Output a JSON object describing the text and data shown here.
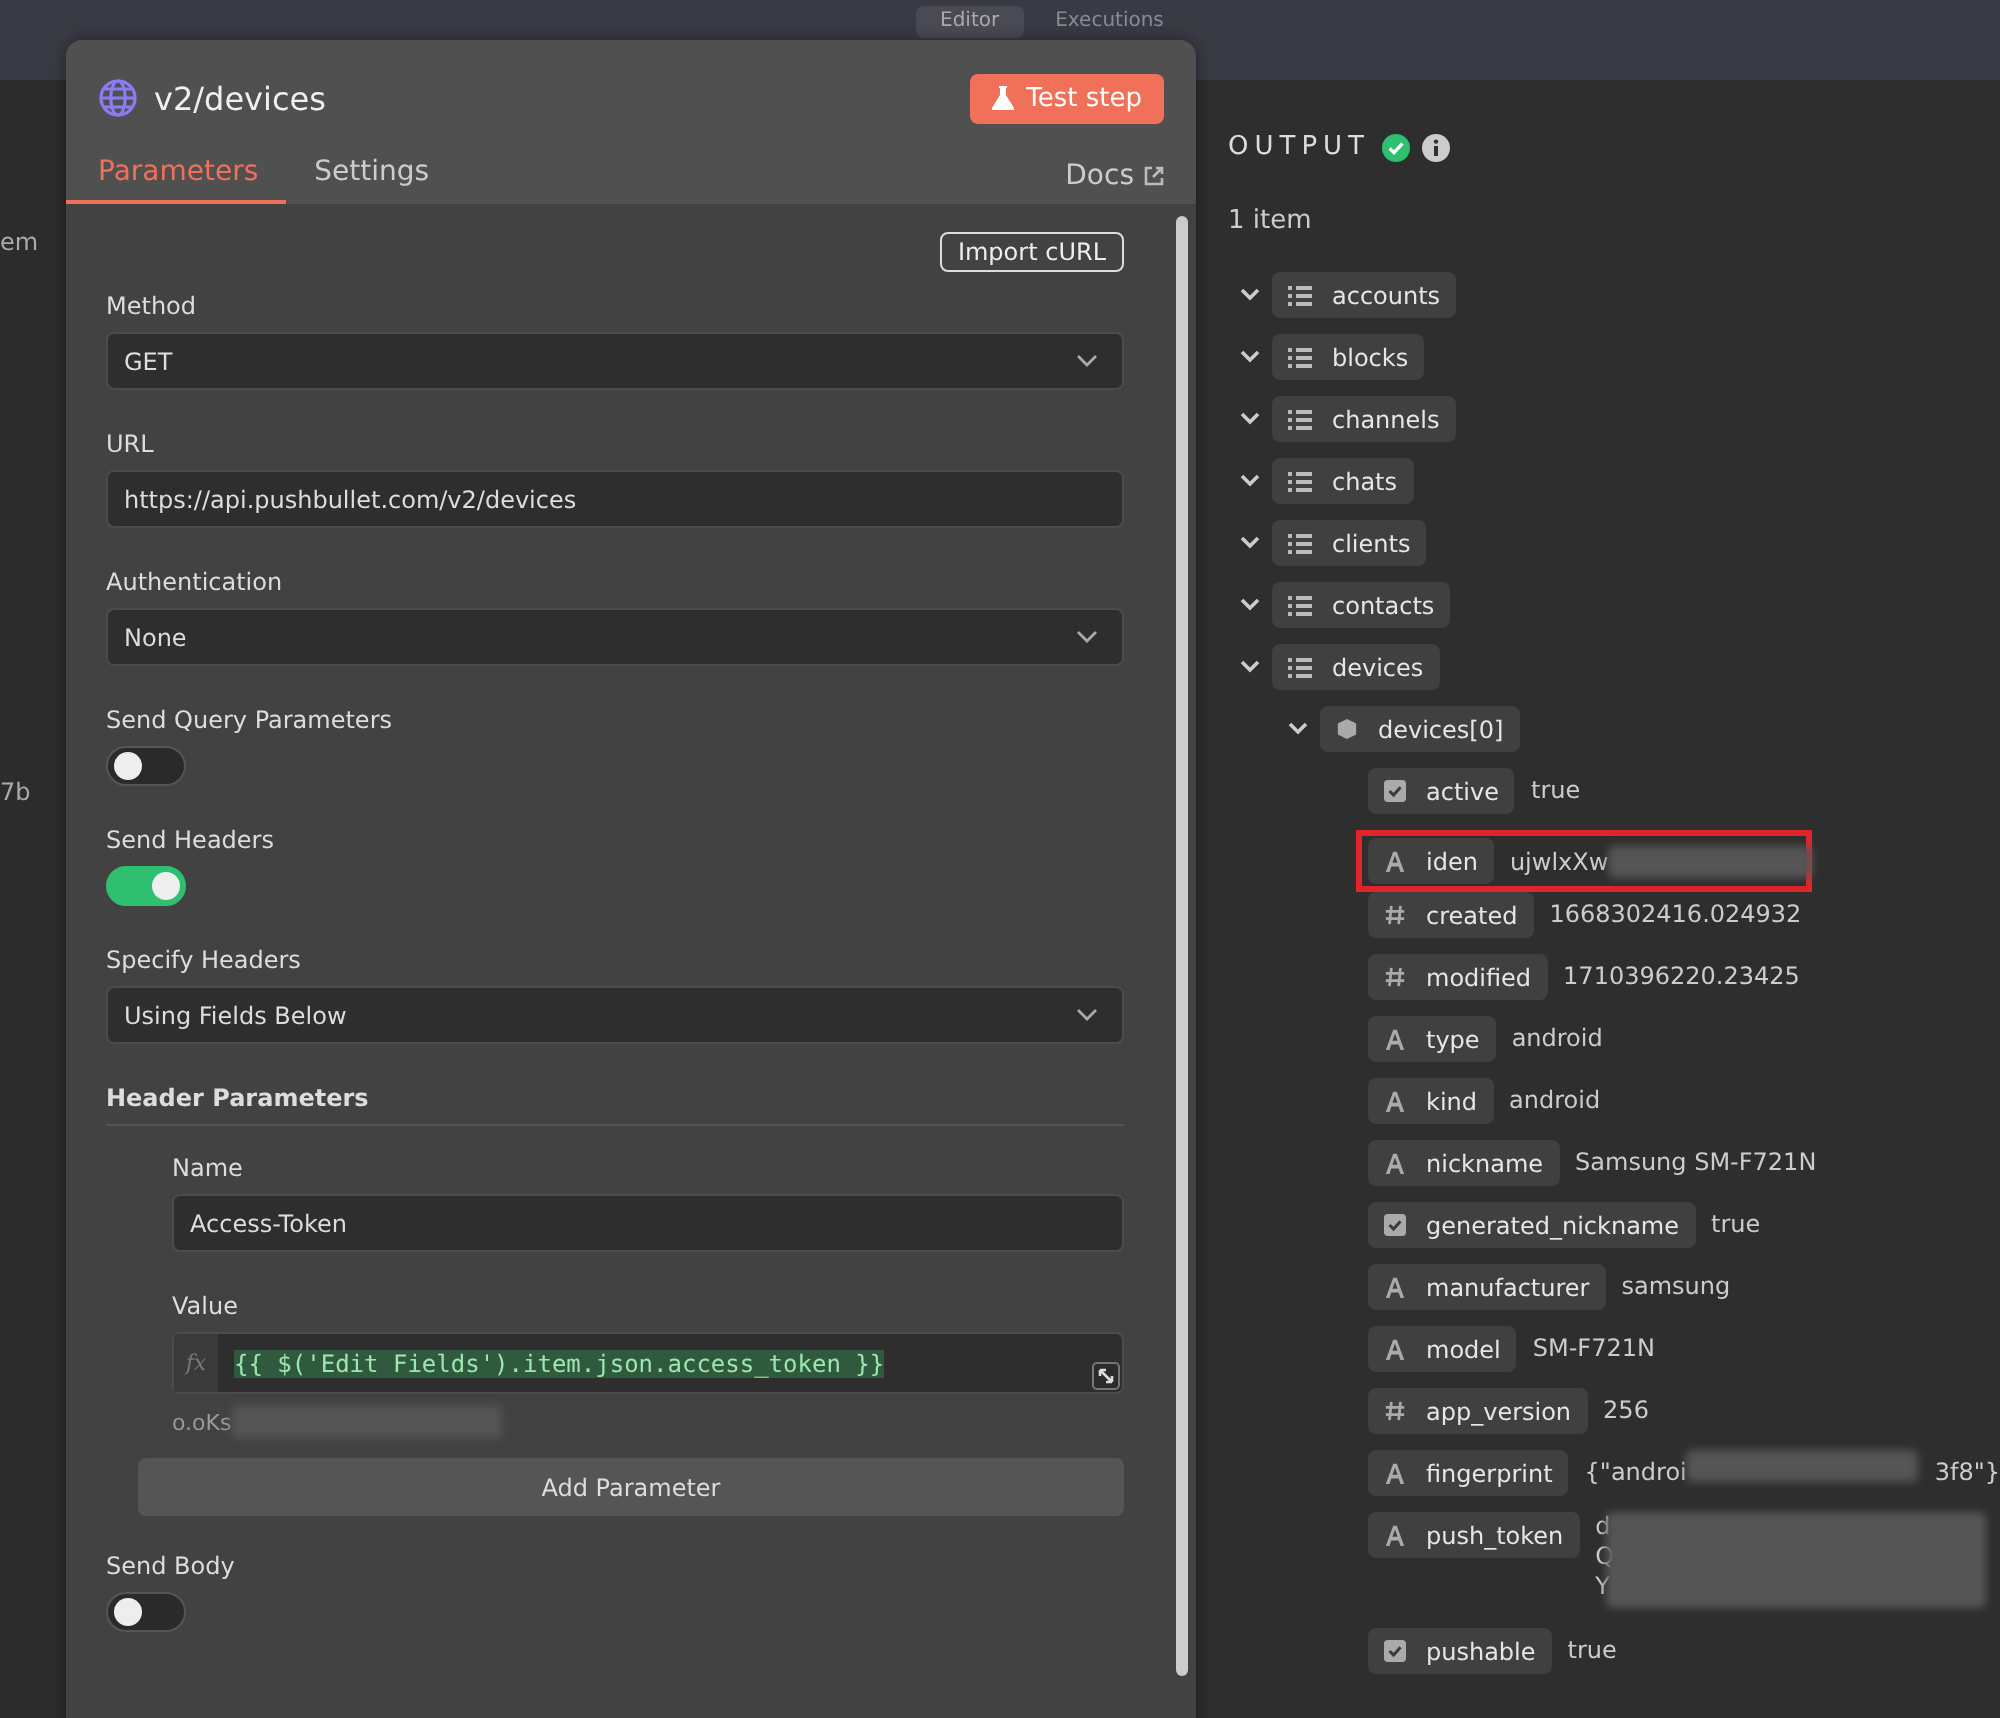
{
  "top_tabs": [
    {
      "label": "Editor",
      "selected": true
    },
    {
      "label": "Executions",
      "selected": false
    }
  ],
  "background_fragments": [
    "em",
    "7b"
  ],
  "node_panel": {
    "title": "v2/devices",
    "test_button": "Test step",
    "tabs": [
      {
        "label": "Parameters",
        "selected": true
      },
      {
        "label": "Settings",
        "selected": false
      }
    ],
    "docs_link": "Docs",
    "import_button": "Import cURL",
    "fields": [
      {
        "kind": "select",
        "label": "Method",
        "value": "GET"
      },
      {
        "kind": "input",
        "label": "URL",
        "value": "https://api.pushbullet.com/v2/devices"
      },
      {
        "kind": "select",
        "label": "Authentication",
        "value": "None"
      },
      {
        "kind": "toggle",
        "label": "Send Query Parameters",
        "on": false
      },
      {
        "kind": "toggle",
        "label": "Send Headers",
        "on": true
      },
      {
        "kind": "select",
        "label": "Specify Headers",
        "value": "Using Fields Below"
      },
      {
        "kind": "section",
        "label": "Header Parameters",
        "name_label": "Name",
        "name_value": "Access-Token",
        "value_label": "Value",
        "expression": "{{ $('Edit Fields').item.json.access_token }}",
        "expression_prefix": "fx",
        "resolved_hint": "o.oKs",
        "add_button": "Add Parameter"
      },
      {
        "kind": "toggle",
        "label": "Send Body",
        "on": false
      }
    ]
  },
  "output": {
    "title": "OUTPUT",
    "count": "1 item",
    "tree": [
      {
        "key": "accounts",
        "kind": "array"
      },
      {
        "key": "blocks",
        "kind": "array"
      },
      {
        "key": "channels",
        "kind": "array"
      },
      {
        "key": "chats",
        "kind": "array"
      },
      {
        "key": "clients",
        "kind": "array"
      },
      {
        "key": "contacts",
        "kind": "array"
      },
      {
        "key": "devices",
        "kind": "array",
        "children": [
          {
            "key": "devices[0]",
            "kind": "object",
            "children": [
              {
                "key": "active",
                "kind": "boolean",
                "value": "true"
              },
              {
                "key": "iden",
                "kind": "string",
                "value": "ujwlxXw",
                "redacted": true,
                "highlighted": true
              },
              {
                "key": "created",
                "kind": "number",
                "value": "1668302416.024932"
              },
              {
                "key": "modified",
                "kind": "number",
                "value": "1710396220.23425"
              },
              {
                "key": "type",
                "kind": "string",
                "value": "android"
              },
              {
                "key": "kind",
                "kind": "string",
                "value": "android"
              },
              {
                "key": "nickname",
                "kind": "string",
                "value": "Samsung SM-F721N"
              },
              {
                "key": "generated_nickname",
                "kind": "boolean",
                "value": "true"
              },
              {
                "key": "manufacturer",
                "kind": "string",
                "value": "samsung"
              },
              {
                "key": "model",
                "kind": "string",
                "value": "SM-F721N"
              },
              {
                "key": "app_version",
                "kind": "number",
                "value": "256"
              },
              {
                "key": "fingerprint",
                "kind": "string",
                "value": "{\"androi",
                "value_end": "3f8\"}",
                "redacted": true
              },
              {
                "key": "push_token",
                "kind": "string",
                "value_lines": [
                  "d",
                  "Q",
                  "Y"
                ],
                "redacted": true
              },
              {
                "key": "pushable",
                "kind": "boolean",
                "value": "true"
              }
            ]
          }
        ]
      }
    ]
  }
}
